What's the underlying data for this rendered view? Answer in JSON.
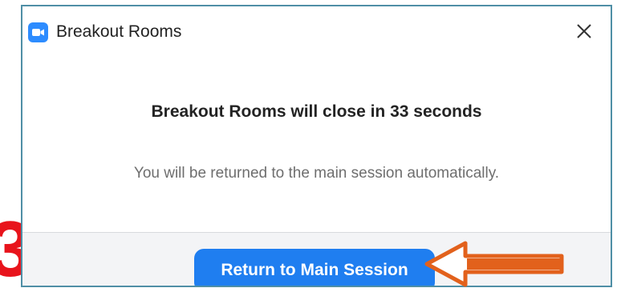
{
  "annotation": {
    "step_number": "3"
  },
  "dialog": {
    "title": "Breakout Rooms",
    "close_label": "×",
    "message": "Breakout Rooms will close in 33 seconds",
    "submessage": "You will be returned to the main session automatically.",
    "primary_button_label": "Return to Main Session"
  },
  "colors": {
    "accent": "#1f7ef0",
    "app_icon": "#2d8cff",
    "annotation_red": "#e8141c",
    "arrow_orange": "#e2611c"
  },
  "icons": {
    "app": "zoom-camera-icon",
    "close": "close-icon",
    "pointer": "arrow-left-icon"
  }
}
